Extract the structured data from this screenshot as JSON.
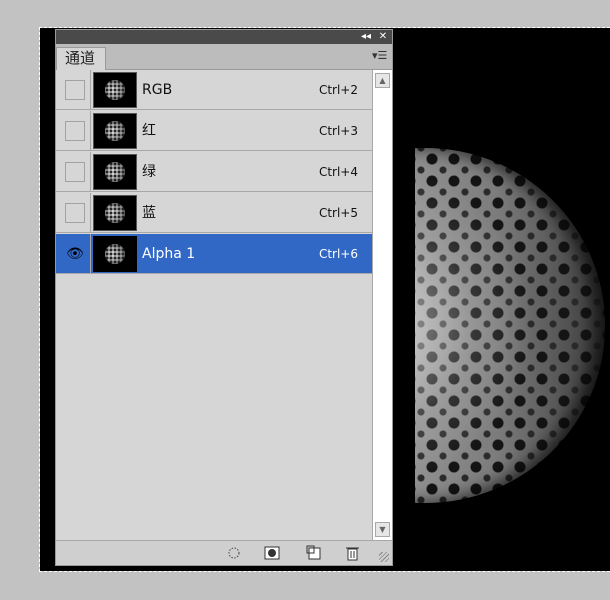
{
  "panel": {
    "tab_label": "通道"
  },
  "channels": [
    {
      "name": "RGB",
      "shortcut": "Ctrl+2",
      "visible": false,
      "selected": false
    },
    {
      "name": "红",
      "shortcut": "Ctrl+3",
      "visible": false,
      "selected": false
    },
    {
      "name": "绿",
      "shortcut": "Ctrl+4",
      "visible": false,
      "selected": false
    },
    {
      "name": "蓝",
      "shortcut": "Ctrl+5",
      "visible": false,
      "selected": false
    },
    {
      "name": "Alpha 1",
      "shortcut": "Ctrl+6",
      "visible": true,
      "selected": true
    }
  ],
  "footer_icons": [
    "load-selection-icon",
    "save-selection-icon",
    "new-channel-icon",
    "delete-channel-icon"
  ],
  "colors": {
    "selection": "#3168c6",
    "panel_bg": "#d6d6d6",
    "titlebar": "#4a4a4a"
  }
}
